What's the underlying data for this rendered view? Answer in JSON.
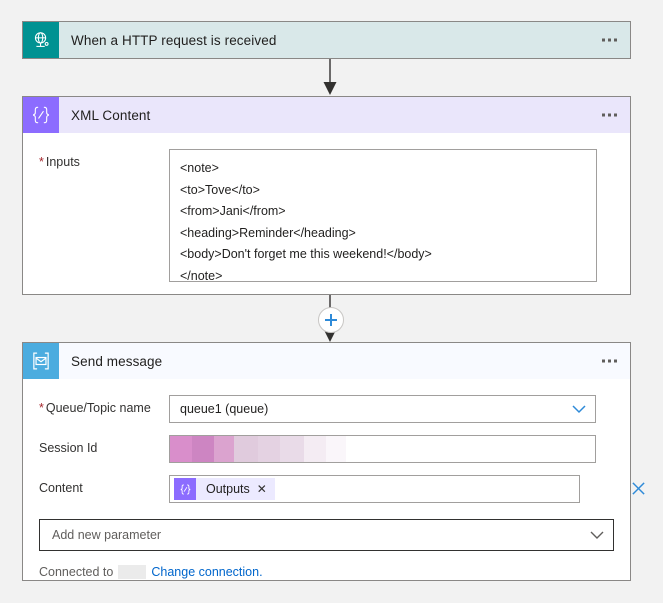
{
  "theme": {
    "canvas_bg": "#f2f2f2",
    "trigger_header_bg": "#d9e8e9",
    "trigger_icon_bg": "#009292",
    "xml_header_bg": "#eae6fb",
    "xml_icon_bg": "#8c6cff",
    "send_header_bg": "#f8faff",
    "send_icon_bg": "#4bacdf",
    "accent_blue": "#2e8ad8",
    "link_blue": "#0066cc",
    "required_red": "#a4262c"
  },
  "trigger_card": {
    "title": "When a HTTP request is received",
    "icon": "http-request-globe-icon",
    "overflow_menu": "…"
  },
  "xml_card": {
    "title": "XML Content",
    "icon": "expression-code-icon",
    "overflow_menu": "…",
    "inputs": {
      "label": "Inputs",
      "required": "*",
      "lines": [
        "<note>",
        "<to>Tove</to>",
        "<from>Jani</from>",
        "<heading>Reminder</heading>",
        "<body>Don't forget me this weekend!</body>",
        "</note>"
      ]
    }
  },
  "connector": {
    "add_step_icon": "plus-icon",
    "arrow_icon": "arrow-down-icon"
  },
  "send_card": {
    "title": "Send message",
    "icon": "service-bus-envelope-icon",
    "overflow_menu": "…",
    "queue_topic": {
      "label": "Queue/Topic name",
      "required": "*",
      "value": "queue1 (queue)",
      "chevron": "chevron-down-icon"
    },
    "session_id": {
      "label": "Session Id",
      "value": "",
      "redacted": true
    },
    "content": {
      "label": "Content",
      "token_label": "Outputs",
      "token_remove": "✕",
      "token_icon": "expression-code-icon",
      "clear_icon": "close-icon"
    },
    "add_new_parameter": {
      "label": "Add new parameter",
      "chevron": "chevron-down-icon"
    },
    "connection": {
      "prefix": "Connected to",
      "account_redacted": true,
      "link_text": "Change connection."
    }
  }
}
